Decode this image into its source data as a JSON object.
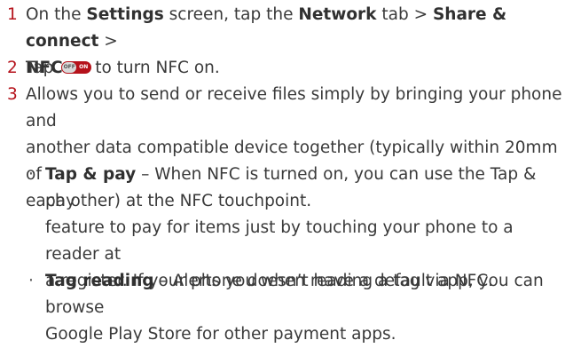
{
  "step1": {
    "number": "1",
    "pre": "On the ",
    "settings": "Settings",
    "mid1": " screen, tap the ",
    "network": "Network",
    "mid2": " tab > ",
    "share": "Share & connect",
    "mid3": " >",
    "nfc": "NFC",
    "end": "."
  },
  "step2": {
    "number": "2",
    "pre": "Tap",
    "toggle_off": "OFF",
    "toggle_on": "ON",
    "post": "to turn NFC on."
  },
  "step3": {
    "number": "3",
    "line1": "Allows you to send or receive files simply by bringing your phone and",
    "line2": "another data compatible device together (typically within 20mm of",
    "line3": "each other) at the NFC touchpoint."
  },
  "bullets": [
    {
      "dot": "·",
      "title": "Tap & pay",
      "line1": " – When NFC is turned on, you can use the Tap & pay",
      "line2": "feature to pay for items just by touching your phone to a reader at",
      "line3": "a register. If your phone doesn’t have a default app, you can browse",
      "line4": "Google Play Store for other payment apps."
    },
    {
      "dot": "·",
      "title": "Tag reading",
      "line1": " – Alerts you when reading a tag via NFC."
    }
  ],
  "colors": {
    "accent": "#b5121b",
    "text": "#3a3a3a"
  }
}
